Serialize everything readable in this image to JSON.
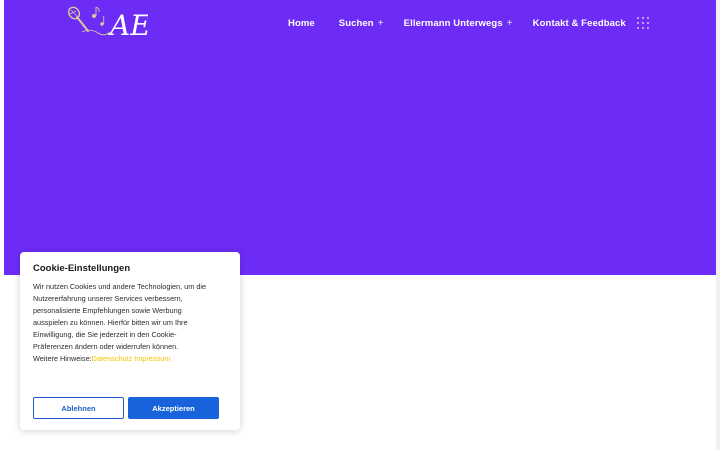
{
  "header": {
    "logo_text": "AE",
    "nav": [
      {
        "label": "Home",
        "has_submenu": false
      },
      {
        "label": "Suchen",
        "has_submenu": true
      },
      {
        "label": "Ellermann Unterwegs",
        "has_submenu": true
      },
      {
        "label": "Kontakt & Feedback",
        "has_submenu": false
      }
    ],
    "submenu_indicator": "+",
    "menu_icon": "grid-dots-icon"
  },
  "colors": {
    "hero_background": "#6d2cf5",
    "nav_text": "#ffffff",
    "link_yellow": "#f5c400",
    "button_blue": "#1863dc"
  },
  "cookie_banner": {
    "title": "Cookie-Einstellungen",
    "body_lines": [
      "Wir nutzen Cookies und andere Technologien, um die",
      "Nutzererfahrung unserer Services verbessern,",
      "personalisierte Empfehlungen sowie Werbung",
      "ausspielen zu können. Hierfür bitten wir um Ihre",
      "Einwilligung, die Sie jederzeit in den Cookie-",
      "Präferenzen ändern oder widerrufen können."
    ],
    "more_info_label": "Weitere Hinweise:",
    "link_privacy": "Datenschutz",
    "link_imprint": "Impressum",
    "decline_label": "Ablehnen",
    "accept_label": "Akzeptieren"
  }
}
